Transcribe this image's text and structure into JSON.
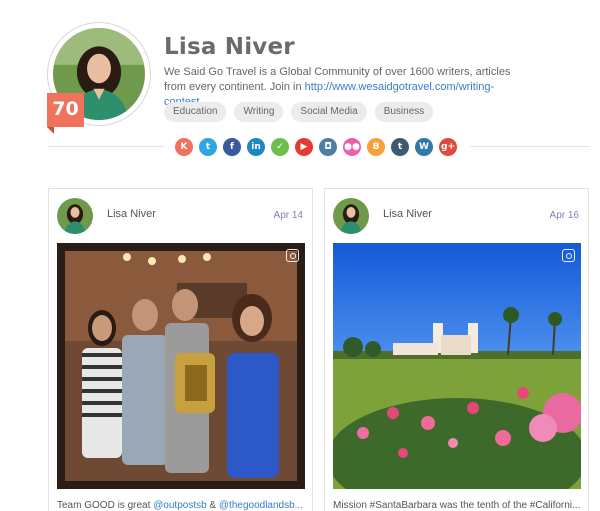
{
  "profile": {
    "name": "Lisa Niver",
    "score": "70",
    "bio_text": "We Said Go Travel is a Global Community of over 1600 writers, articles from every continent. Join in ",
    "bio_link": "http://www.wesaidgotravel.com/writing-contest",
    "tags": [
      "Education",
      "Writing",
      "Social Media",
      "Business"
    ]
  },
  "social": [
    {
      "icon": "klout-icon",
      "glyph": "K",
      "color": "#f0715c"
    },
    {
      "icon": "twitter-icon",
      "glyph": "t",
      "color": "#2ea7e0"
    },
    {
      "icon": "facebook-icon",
      "glyph": "f",
      "color": "#3b5a9b"
    },
    {
      "icon": "linkedin-icon",
      "glyph": "in",
      "color": "#1f86c1"
    },
    {
      "icon": "feedly-icon",
      "glyph": "✓",
      "color": "#6cc04a"
    },
    {
      "icon": "youtube-icon",
      "glyph": "▶",
      "color": "#e53a2f"
    },
    {
      "icon": "instagram-icon",
      "glyph": "◘",
      "color": "#4d7ea8"
    },
    {
      "icon": "flickr-icon",
      "glyph": "●●",
      "color": "#ee5fa9"
    },
    {
      "icon": "blogger-icon",
      "glyph": "B",
      "color": "#f6a13b"
    },
    {
      "icon": "tumblr-icon",
      "glyph": "t",
      "color": "#3d5a74"
    },
    {
      "icon": "wordpress-icon",
      "glyph": "W",
      "color": "#2e79a8"
    },
    {
      "icon": "googleplus-icon",
      "glyph": "g+",
      "color": "#e04a39"
    }
  ],
  "posts": [
    {
      "author": "Lisa Niver",
      "date": "Apr 14",
      "caption_text": "Team GOOD is great ",
      "mention_1": "@outpostsb",
      "caption_mid": " & ",
      "mention_2": "@thegoodlandsb...",
      "colors": {
        "wall": "#8b5a3c",
        "shirt": "#2f7d6a"
      }
    },
    {
      "author": "Lisa Niver",
      "date": "Apr 16",
      "caption_text": "Mission #SantaBarbara was the tenth of the #Californi...",
      "colors": {
        "sky": "#1f6fe6",
        "grass": "#7ea23a",
        "roses": "#e86aa0"
      }
    }
  ]
}
